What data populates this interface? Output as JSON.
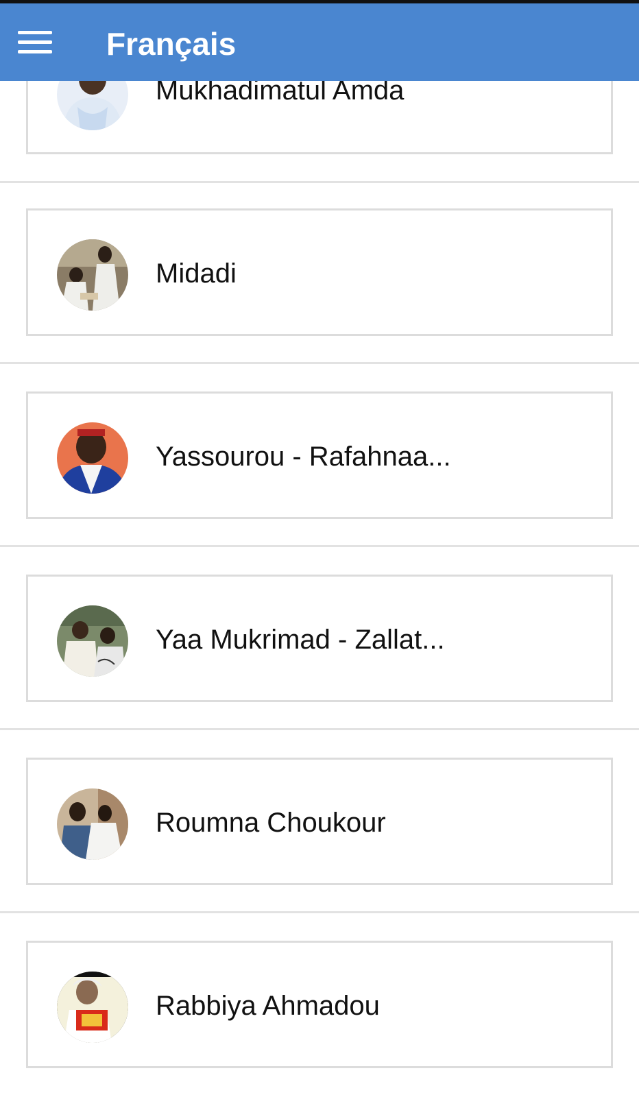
{
  "appbar": {
    "title": "Français",
    "menu_icon": "hamburger-menu-icon",
    "color": "#4a86d0"
  },
  "items": [
    {
      "label": "Mukhadimatul Amda"
    },
    {
      "label": "Midadi"
    },
    {
      "label": "Yassourou - Rafahnaa..."
    },
    {
      "label": "Yaa Mukrimad - Zallat..."
    },
    {
      "label": "Roumna Choukour"
    },
    {
      "label": "Rabbiya Ahmadou"
    }
  ]
}
